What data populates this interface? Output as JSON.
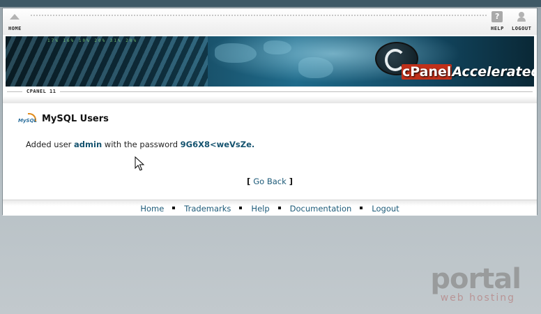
{
  "topnav": {
    "home_label": "HOME",
    "help_label": "HELP",
    "logout_label": "LOGOUT"
  },
  "banner": {
    "brand_prefix": "cPanel",
    "brand_suffix": "Accelerated",
    "binary_text": "17% 16% 10% 20% 31% 20%"
  },
  "breadcrumb": {
    "label": "CPANEL 11"
  },
  "page": {
    "icon_text": "MySQL",
    "title": "MySQL Users",
    "message_prefix": "Added user ",
    "user": "admin",
    "message_middle": " with the password ",
    "password": "9G6X8<weVsZe",
    "message_suffix": ".",
    "go_back_open": "[ ",
    "go_back_label": "Go Back",
    "go_back_close": " ]"
  },
  "footer": {
    "links": [
      "Home",
      "Trademarks",
      "Help",
      "Documentation",
      "Logout"
    ]
  },
  "watermark": {
    "main": "portal",
    "sub": "web hosting"
  },
  "colors": {
    "link": "#1c5a78",
    "highlight": "#15536f",
    "outer_background": "#b8c1c6"
  }
}
